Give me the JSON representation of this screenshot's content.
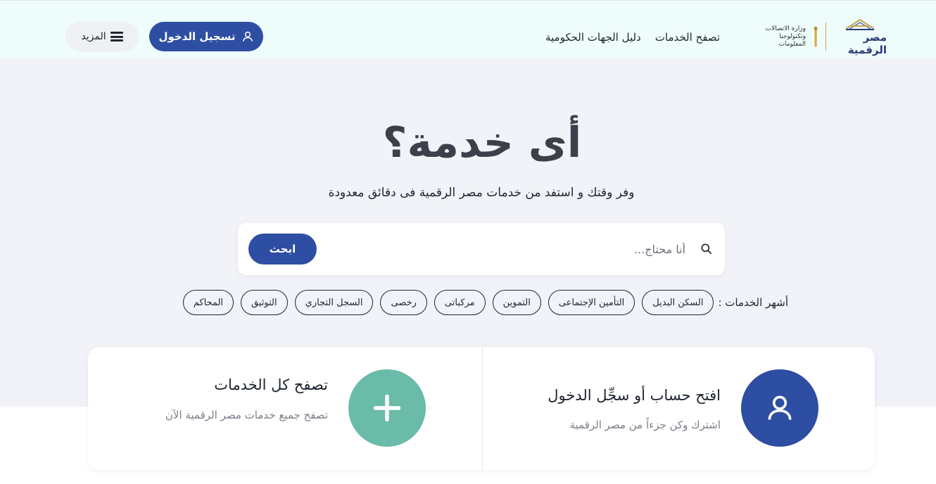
{
  "header": {
    "logo": {
      "digital_egypt": "مصر الرقمية",
      "ministry_line1": "وزارة الاتصالات",
      "ministry_line2": "وتكنولوجيا المعلومات"
    },
    "nav": [
      {
        "label": "تصفح الخدمات"
      },
      {
        "label": "دليل الجهات الحكومية"
      }
    ],
    "login_label": "تسجيل الدخول",
    "more_label": "المزيد"
  },
  "hero": {
    "title": "أى خدمة؟",
    "subtitle": "وفر وقتك و استفد من خدمات مصر الرقمية فى دقائق معدودة"
  },
  "search": {
    "placeholder": "أنا محتاج...",
    "value": "",
    "button_label": "ابحث"
  },
  "popular": {
    "label": "أشهر الخدمات :",
    "chips": [
      {
        "label": "السكن البديل"
      },
      {
        "label": "التأمين الإجتماعى"
      },
      {
        "label": "التموين"
      },
      {
        "label": "مركباتى"
      },
      {
        "label": "رخصى"
      },
      {
        "label": "السجل التجاري"
      },
      {
        "label": "التوثيق"
      },
      {
        "label": "المحاكم"
      }
    ]
  },
  "cards": {
    "account": {
      "title": "افتح حساب أو سجِّل الدخول",
      "description": "اشترك وكن جزءاً من مصر الرقمية",
      "icon": "user-icon"
    },
    "browse": {
      "title": "تصفح كل الخدمات",
      "description": "تصفح جميع خدمات مصر الرقمية الآن",
      "icon": "plus-icon"
    }
  },
  "colors": {
    "primary": "#2e4ea3",
    "accent_green": "#6abba8",
    "header_bg": "#eefcfb",
    "hero_bg": "#f1f3f8"
  }
}
